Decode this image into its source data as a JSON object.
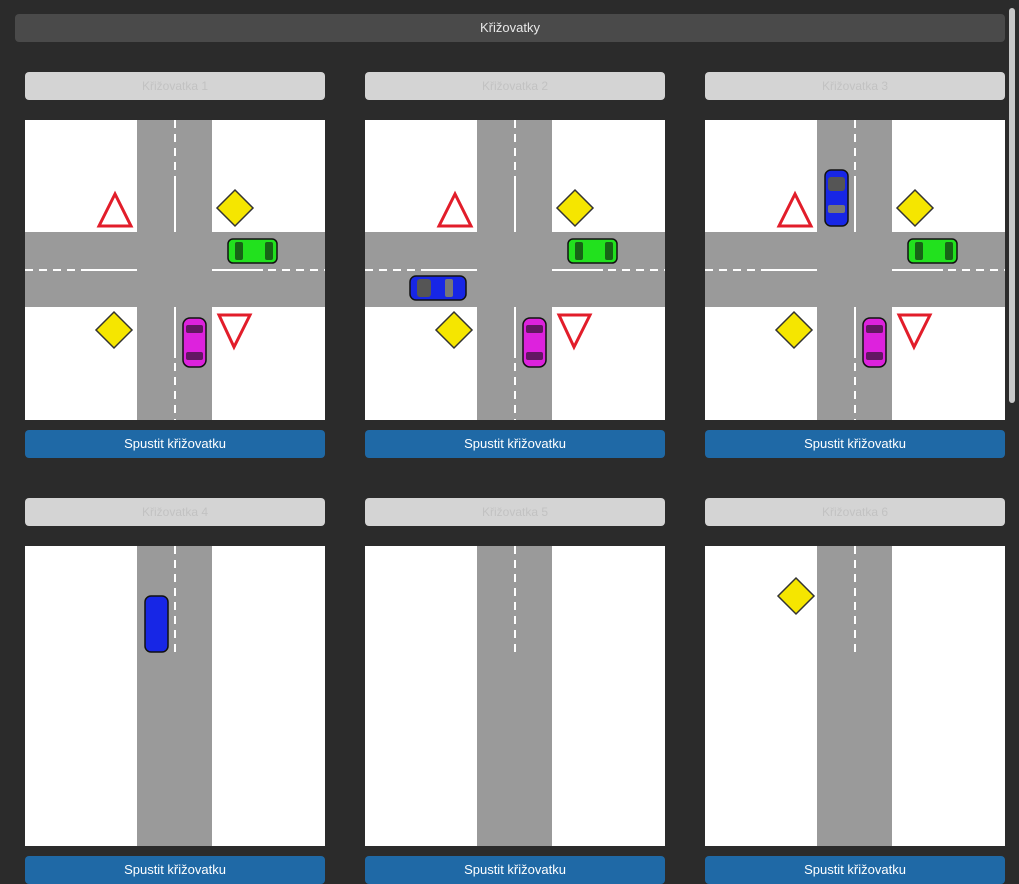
{
  "header": {
    "title": "Křižovatky"
  },
  "colors": {
    "road": "#9a9a9a",
    "run_button": "#1f69a6",
    "car_green": "#22e11e",
    "car_blue": "#1726e6",
    "car_magenta": "#dd22dd",
    "sign_yellow": "#f5e600",
    "sign_red": "#e21d2a"
  },
  "cards": [
    {
      "title": "Křižovatka 1",
      "button": "Spustit křižovatku"
    },
    {
      "title": "Křižovatka 2",
      "button": "Spustit křižovatku"
    },
    {
      "title": "Křižovatka 3",
      "button": "Spustit křižovatku"
    },
    {
      "title": "Křižovatka 4",
      "button": "Spustit křižovatku"
    },
    {
      "title": "Křižovatka 5",
      "button": "Spustit křižovatku"
    },
    {
      "title": "Křižovatka 6",
      "button": "Spustit křižovatku"
    }
  ]
}
